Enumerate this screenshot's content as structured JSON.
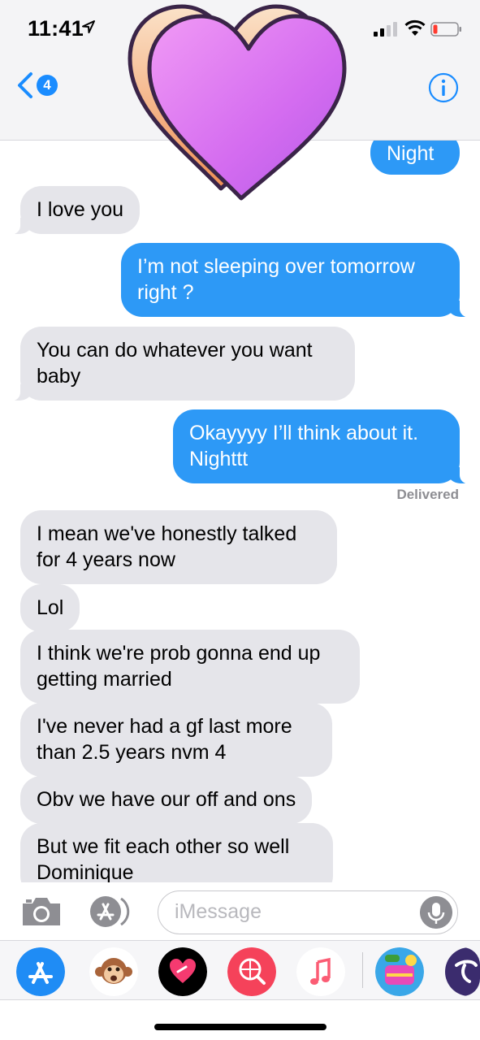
{
  "status_bar": {
    "time": "11:41",
    "battery_color": "#ff3b30"
  },
  "nav": {
    "back_badge_count": "4",
    "back_icon": "chevron-left-icon",
    "info_icon": "info-icon"
  },
  "sticker": {
    "icon": "purple-heart-sticker",
    "color": "#d96ff0"
  },
  "messages": [
    {
      "sender": "me",
      "text": "Night"
    },
    {
      "sender": "them",
      "text": "I love you"
    },
    {
      "sender": "me",
      "text": "I’m not sleeping over tomorrow\nright ?"
    },
    {
      "sender": "them",
      "text": "You can do whatever you want\nbaby"
    },
    {
      "sender": "me",
      "text": "Okayyyy I’ll think about it.\nNighttt"
    },
    {
      "sender": "them",
      "text": "I mean we've honestly talked\nfor 4 years now"
    },
    {
      "sender": "them",
      "text": "Lol"
    },
    {
      "sender": "them",
      "text": "I think we're prob gonna end up\ngetting married"
    },
    {
      "sender": "them",
      "text": "I've never had a gf last more\nthan 2.5 years nvm 4"
    },
    {
      "sender": "them",
      "text": "Obv we have our off and ons"
    },
    {
      "sender": "them",
      "text": "But we fit each other so well\nDominique"
    }
  ],
  "delivered_label": "Delivered",
  "input": {
    "placeholder": "iMessage"
  },
  "colors": {
    "outgoing_bubble": "#2d99f6",
    "incoming_bubble": "#e5e5ea",
    "accent": "#1a8cff"
  },
  "app_drawer": [
    {
      "name": "App Store",
      "icon": "app-store-icon"
    },
    {
      "name": "Animoji",
      "icon": "monkey-icon"
    },
    {
      "name": "Digital Touch",
      "icon": "heart-touch-icon"
    },
    {
      "name": "Images",
      "icon": "globe-search-icon"
    },
    {
      "name": "Music",
      "icon": "music-note-icon"
    },
    {
      "name": "Candy Crush Jelly",
      "icon": "candy-game-icon"
    },
    {
      "name": "More",
      "icon": "app-icon"
    }
  ]
}
